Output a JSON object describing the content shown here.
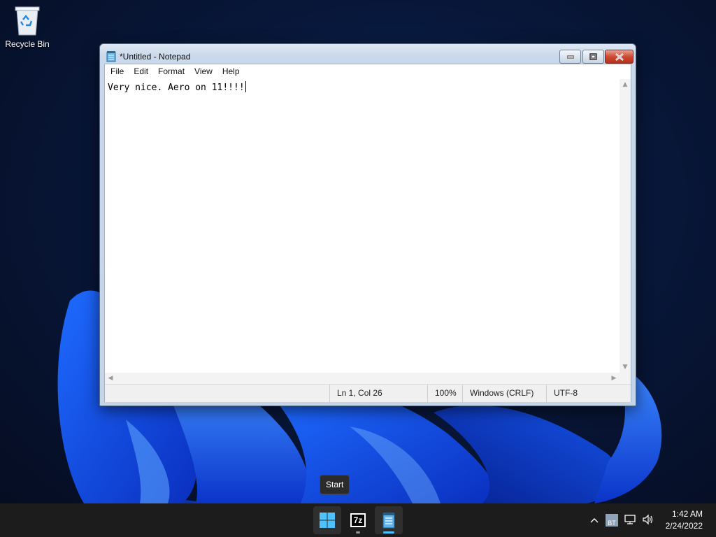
{
  "desktop": {
    "icons": [
      {
        "label": "Recycle Bin",
        "icon": "recycle-bin-icon"
      }
    ]
  },
  "window": {
    "title": "*Untitled - Notepad",
    "app_icon": "notepad-icon",
    "controls": [
      "minimize",
      "maximize",
      "close"
    ],
    "menu": [
      "File",
      "Edit",
      "Format",
      "View",
      "Help"
    ],
    "editor_text": "Very nice. Aero on 11!!!!",
    "status": {
      "position": "Ln 1, Col 26",
      "zoom": "100%",
      "line_ending": "Windows (CRLF)",
      "encoding": "UTF-8"
    }
  },
  "tooltip": {
    "text": "Start"
  },
  "taskbar": {
    "apps": [
      {
        "name": "start-button",
        "icon": "windows-logo-icon"
      },
      {
        "name": "7zip",
        "icon": "7z-icon",
        "label": "7z"
      },
      {
        "name": "notepad",
        "icon": "notepad-icon"
      }
    ],
    "tray": {
      "icons": [
        "chevron-up-icon",
        "bluetooth-icon",
        "network-icon",
        "volume-icon"
      ],
      "bt_label": "BT"
    },
    "clock": {
      "time": "1:42 AM",
      "date": "2/24/2022"
    }
  },
  "colors": {
    "accent": "#4cc2ff",
    "taskbar": "#1c1c1c",
    "close_button": "#cf4a33"
  }
}
